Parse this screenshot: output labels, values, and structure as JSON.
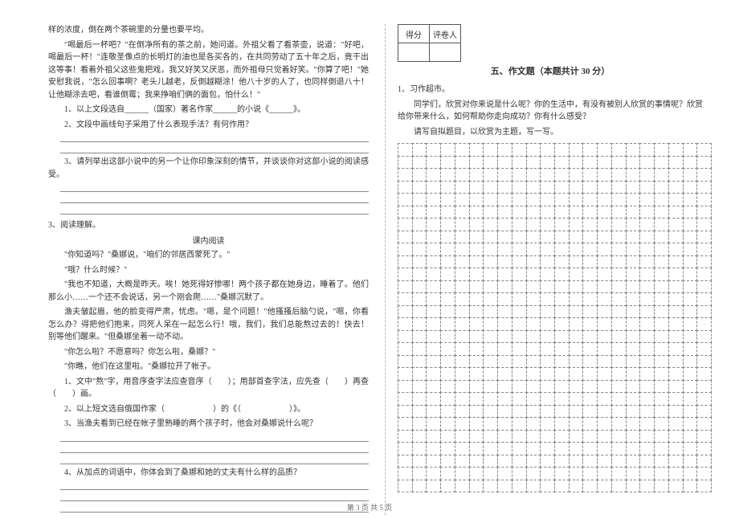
{
  "left": {
    "para1": "样的浓度，倒在两个茶碗里的分量也要平均。",
    "para2": "\"喝最后一杯吧？\"在倒净所有的茶之前，她问道。外祖父看了看茶壶，说道：\"好吧，喝最后一杯！\"连敬圣像点的长明灯的油也是各买各的，在共同劳动了五十年之后，竟干出这等事！看着外祖父这些鬼把戏，我又好笑又厌恶，而外祖母只觉着好笑。\"你算了吧！\"她安慰我说，\"怎么回事啊？老头儿越老，反倒越糊涂！他八十岁的人了，也同样倒退八十！让他糊涂去吧，看谁倒霉；我来挣咱们俩的面包，怕什么！\"",
    "q1": "1、以上文段选自______（国家）著名作家______的小说《______》。",
    "q2": "2、文段中画线句子采用了什么表现手法？有何作用？",
    "q3": "3、请列举出这部小说中的另一个让你印象深刻的情节，并谈谈你对这部小说的阅读感受。",
    "section3_title": "3、阅读理解。",
    "subheading": "课内阅读",
    "p_a": "\"你知道吗？\"桑娜说，\"咱们的邻居西蒙死了。\"",
    "p_b": "\"哦？什么时候？\"",
    "p_c": "\"我也不知道，大概是昨天。唉！她死得好惨哪！两个孩子都在她身边，睡着了。他们那么小……一个还不会说话，另一个刚会爬……\"桑娜沉默了。",
    "p_d": "渔夫皱起眉，他的脸变得严肃，忧虑。\"嗯，是个问题！\"他搔搔后脑勺说，\"嗯，你看怎么办？得把他们抱来，同死人呆在一起怎么行！哦，我们，我们总能熬过去的！快去！别等他们醒来。\"但桑娜坐着一动不动。",
    "p_e": "\"你怎么啦？不愿意吗？你怎么啦，桑娜？\"",
    "p_f": "\"你瞧，他们在这里啦。\"桑娜拉开了帐子。",
    "rq1": "1、文中\"熬\"字，用音序查字法应查音序（　　）；用部首查字法，应先查（　　）再查（　　）画。",
    "rq2": "2、以上短文选自俄国作家（　　　　　　）的《（　　　　　　）》。",
    "rq3": "3、当渔夫看到已经在帐子里熟睡的两个孩子时，他会对桑娜说什么呢？",
    "rq4": "4、从加点的词语中，你体会到了桑娜和她的丈夫有什么样的品质？"
  },
  "right": {
    "score_label1": "得分",
    "score_label2": "评卷人",
    "section_title": "五、作文题（本题共计 30 分）",
    "essay_num": "1、习作超市。",
    "essay_p1": "同学们，欣赏对你来说是什么呢？你的生活中，有没有被别人欣赏的事情呢？欣赏给你带来什么，如何帮助你走向成功？你有什么感受？",
    "essay_p2": "请写自拟题目，以欣赏为主题，写一写。"
  },
  "footer": "第 3 页 共 5 页"
}
